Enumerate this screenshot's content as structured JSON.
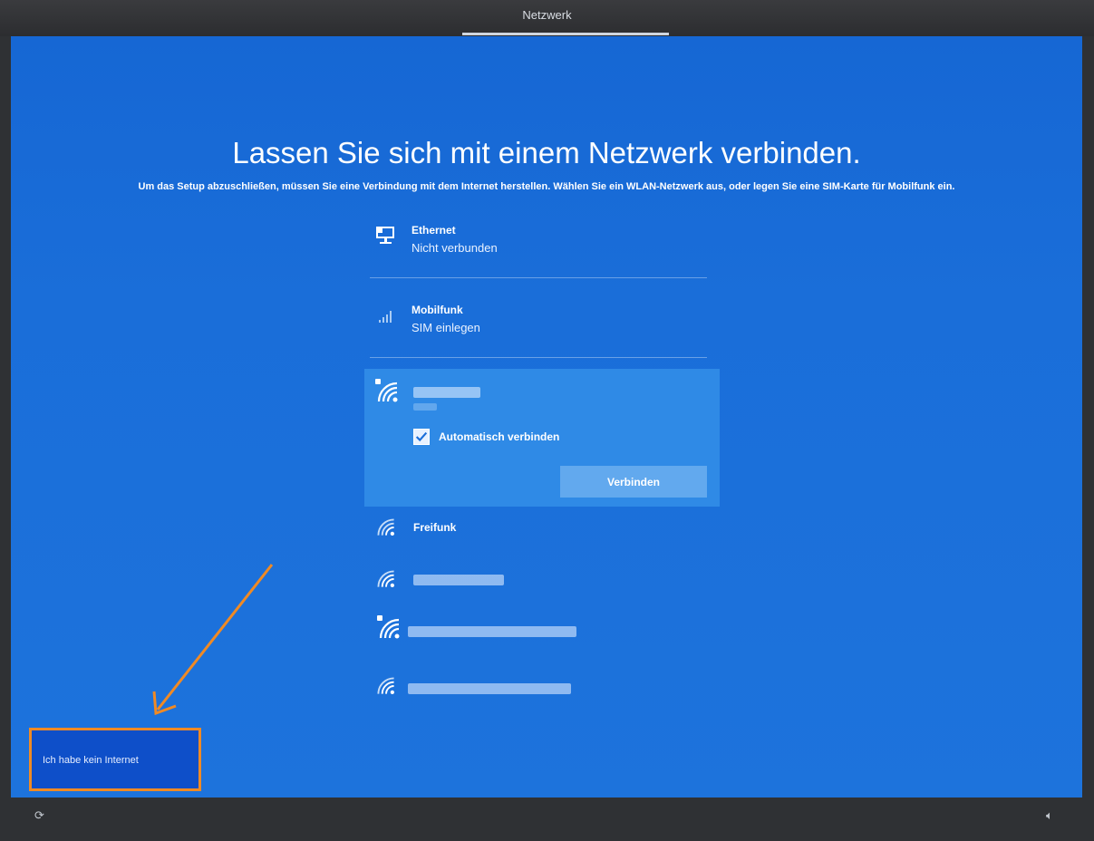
{
  "topbar": {
    "title": "Netzwerk"
  },
  "page": {
    "heading": "Lassen Sie sich mit einem Netzwerk verbinden.",
    "subheading": "Um das Setup abzuschließen, müssen Sie eine Verbindung mit dem Internet herstellen. Wählen Sie ein WLAN-Netzwerk aus, oder legen Sie eine SIM-Karte für Mobilfunk ein."
  },
  "networks": {
    "ethernet": {
      "name": "Ethernet",
      "status": "Nicht verbunden",
      "icon": "ethernet-icon"
    },
    "mobile": {
      "name": "Mobilfunk",
      "status": "SIM einlegen",
      "icon": "cellular-signal-icon"
    },
    "selected_wifi": {
      "icon": "wifi-secured-icon",
      "auto_connect_label": "Automatisch verbinden",
      "auto_connect_checked": true,
      "connect_label": "Verbinden"
    },
    "wifi_list": [
      {
        "name": "Freifunk",
        "icon": "wifi-icon"
      }
    ]
  },
  "no_internet": {
    "label": "Ich habe kein Internet"
  },
  "colors": {
    "background": "#1a6ed9",
    "selected": "#2f8ae6",
    "button": "#62a9ee",
    "highlight": "#f08a24"
  }
}
